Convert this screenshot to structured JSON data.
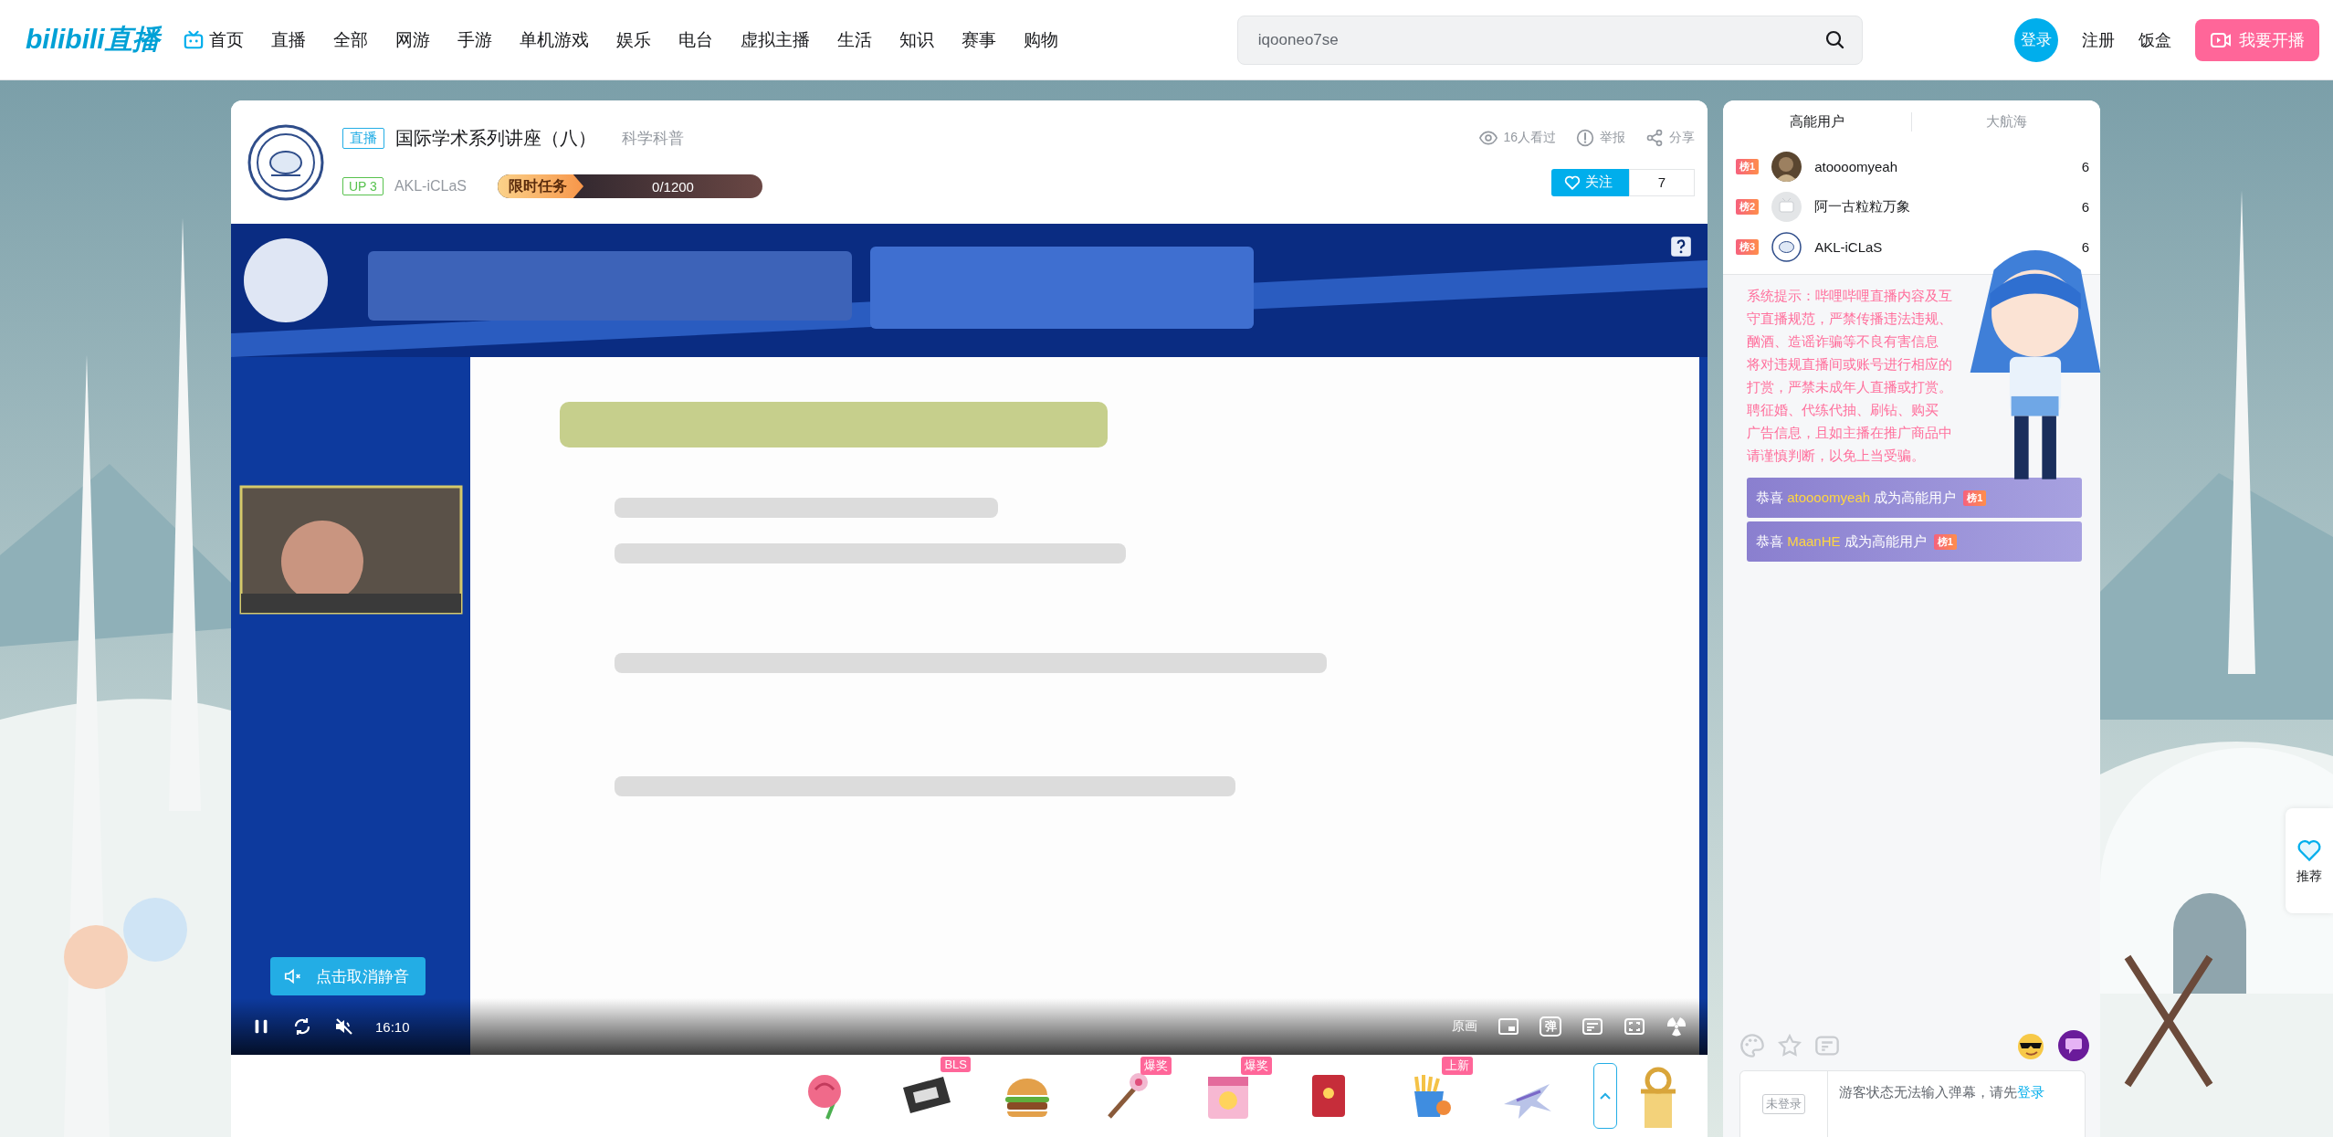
{
  "nav": {
    "logo": "bilibili直播",
    "items": [
      {
        "label": "首页",
        "icon": true
      },
      {
        "label": "直播",
        "icon": false
      },
      {
        "label": "全部",
        "icon": false
      },
      {
        "label": "网游",
        "icon": false
      },
      {
        "label": "手游",
        "icon": false
      },
      {
        "label": "单机游戏",
        "icon": false
      },
      {
        "label": "娱乐",
        "icon": false
      },
      {
        "label": "电台",
        "icon": false
      },
      {
        "label": "虚拟主播",
        "icon": false
      },
      {
        "label": "生活",
        "icon": false
      },
      {
        "label": "知识",
        "icon": false
      },
      {
        "label": "赛事",
        "icon": false
      },
      {
        "label": "购物",
        "icon": false
      }
    ],
    "search": {
      "placeholder": "iqooneo7se"
    },
    "login": "登录",
    "links": [
      "注册",
      "饭盒"
    ],
    "live_button": "我要开播"
  },
  "header": {
    "live_tag": "直播",
    "title": "国际学术系列讲座（八）",
    "category": "科学科普",
    "up_level": "UP 3",
    "streamer": "AKL-iCLaS",
    "task": {
      "label": "限时任务",
      "progress": "0/1200",
      "level": 0
    },
    "stats": [
      {
        "kind": "views",
        "text": "16人看过"
      },
      {
        "kind": "report",
        "text": "举报"
      },
      {
        "kind": "share",
        "text": "分享"
      }
    ],
    "follow": {
      "label": "关注",
      "count": "7"
    }
  },
  "player": {
    "mute_toast": "点击取消静音",
    "time": "16:10",
    "quality": "原画",
    "danmaku_toggle": "弹"
  },
  "gifts": [
    {
      "kind": "rose"
    },
    {
      "kind": "card",
      "badge": "BLS"
    },
    {
      "kind": "burger"
    },
    {
      "kind": "wand",
      "badge": "爆奖"
    },
    {
      "kind": "box",
      "badge": "爆奖"
    },
    {
      "kind": "envelope"
    },
    {
      "kind": "fries",
      "badge": "上新"
    },
    {
      "kind": "jet"
    }
  ],
  "side": {
    "tabs": [
      {
        "label": "高能用户",
        "selected": true
      },
      {
        "label": "大航海",
        "selected": false
      }
    ],
    "ranking": [
      {
        "rank": "榜1",
        "name": "atoooomyeah",
        "score": "6"
      },
      {
        "rank": "榜2",
        "name": "阿一古粒粒万象",
        "score": "6",
        "kind": "default"
      },
      {
        "rank": "榜3",
        "name": "AKL-iCLaS",
        "score": "6",
        "kind": "emblem"
      }
    ],
    "system_notice": [
      "系统提示：哔哩哔哩直播内容及互",
      "守直播规范，严禁传播违法违规、",
      "酗酒、造谣诈骗等不良有害信息",
      "将对违规直播间或账号进行相应的",
      "打赏，严禁未成年人直播或打赏。",
      "聘征婚、代练代抽、刷钻、购买",
      "广告信息，且如主播在推广商品中",
      "请谨慎判断，以免上当受骗。"
    ],
    "notices": [
      {
        "prefix": "恭喜",
        "user": "atoooomyeah",
        "suffix": "成为高能用户",
        "badge": "榜1"
      },
      {
        "prefix": "恭喜",
        "user": "MaanHE",
        "suffix": "成为高能用户",
        "badge": "榜1"
      }
    ],
    "guest_badge": "未登录",
    "guest_prompt": "游客状态无法输入弹幕，请先",
    "login_link": "登录"
  },
  "recommend": "推荐"
}
